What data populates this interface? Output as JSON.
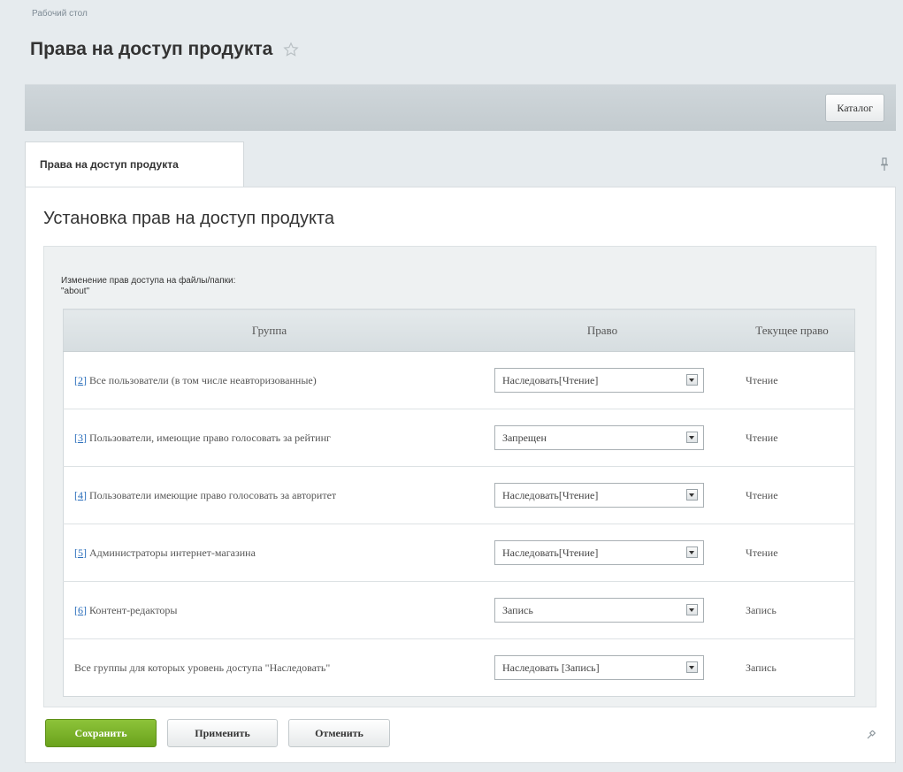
{
  "breadcrumb": "Рабочий стол",
  "page_title": "Права на доступ продукта",
  "toolbar": {
    "catalog_label": "Каталог"
  },
  "tabs": [
    {
      "label": "Права на доступ продукта"
    }
  ],
  "section_title": "Установка прав на доступ продукта",
  "description": {
    "line1": "Изменение прав доступа на файлы/папки:",
    "line2": "\"about\""
  },
  "table": {
    "headers": [
      "Группа",
      "Право",
      "Текущее право"
    ],
    "rows": [
      {
        "id": "[2]",
        "group": " Все пользователи (в том числе неавторизованные)",
        "right": "Наследовать[Чтение]",
        "current": "Чтение"
      },
      {
        "id": "[3]",
        "group": " Пользователи, имеющие право голосовать за рейтинг",
        "right": "Запрещен",
        "current": "Чтение"
      },
      {
        "id": "[4]",
        "group": " Пользователи имеющие право голосовать за авторитет",
        "right": "Наследовать[Чтение]",
        "current": "Чтение"
      },
      {
        "id": "[5]",
        "group": " Администраторы интернет-магазина",
        "right": "Наследовать[Чтение]",
        "current": "Чтение"
      },
      {
        "id": "[6]",
        "group": " Контент-редакторы",
        "right": "Запись",
        "current": "Запись"
      },
      {
        "id": "",
        "group": "Все группы для которых уровень доступа \"Наследовать\"",
        "right": "Наследовать [Запись]",
        "current": "Запись"
      }
    ]
  },
  "buttons": {
    "save": "Сохранить",
    "apply": "Применить",
    "cancel": "Отменить"
  },
  "colors": {
    "save_green": "#7ab22a",
    "link_blue": "#2a6ebb"
  }
}
